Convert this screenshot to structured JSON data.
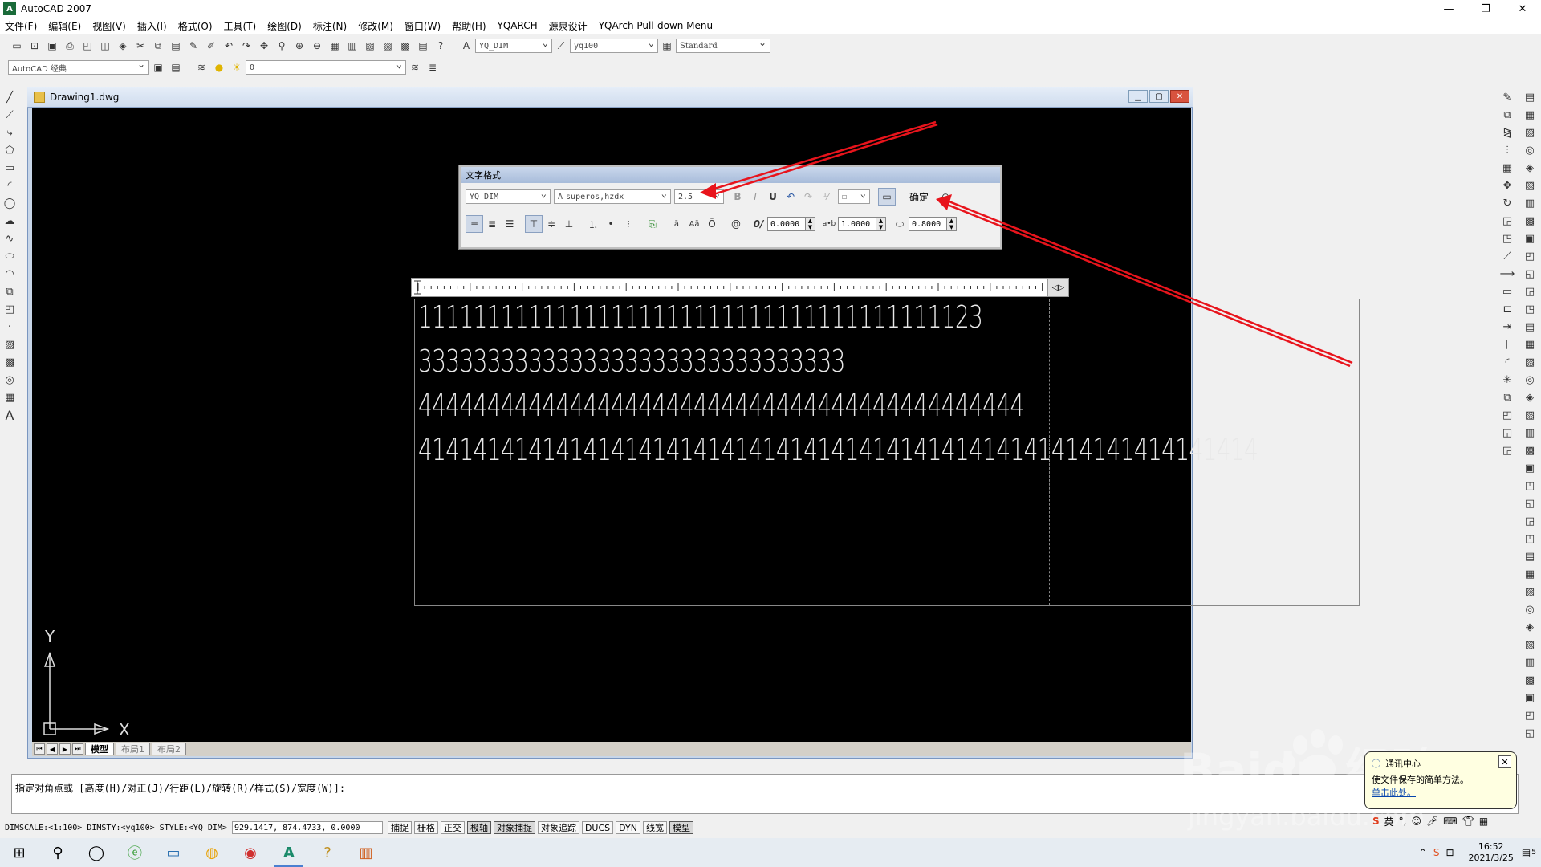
{
  "app": {
    "title": "AutoCAD 2007",
    "win_buttons": [
      "—",
      "❐",
      "✕"
    ]
  },
  "menu": [
    "文件(F)",
    "编辑(E)",
    "视图(V)",
    "插入(I)",
    "格式(O)",
    "工具(T)",
    "绘图(D)",
    "标注(N)",
    "修改(M)",
    "窗口(W)",
    "帮助(H)",
    "YQARCH",
    "源泉设计",
    "YQArch Pull-down Menu"
  ],
  "toolbar1": {
    "dimstyle": "YQ_DIM",
    "textstyle": "yq100",
    "tablestyle": "Standard"
  },
  "toolbar2": {
    "workspace": "AutoCAD 经典",
    "layer": "0"
  },
  "drawing": {
    "title": "Drawing1.dwg",
    "tabs": [
      "模型",
      "布局1",
      "布局2"
    ]
  },
  "text_format": {
    "title": "文字格式",
    "style": "YQ_DIM",
    "font": "superos,hzdx",
    "height": "2.5",
    "ok": "确定",
    "oblique": "0.0000",
    "tracking": "1.0000",
    "width": "0.8000"
  },
  "mtext_lines": [
    "11111111111111111111111111111111111111123",
    "3333333333333333333333333333333",
    "44444444444444444444444444444444444444444444",
    "4141414141414141414141414141414141414141414141414141414141414"
  ],
  "ucs": {
    "y": "Y",
    "x": "X"
  },
  "command": {
    "prompt": "指定对角点或 [高度(H)/对正(J)/行距(L)/旋转(R)/样式(S)/宽度(W)]:"
  },
  "status": {
    "dimscale": "DIMSCALE:<1:100> DIMSTY:<yq100> STYLE:<YQ_DIM>",
    "coords": "929.1417, 874.4733, 0.0000",
    "buttons": [
      "捕捉",
      "栅格",
      "正交",
      "极轴",
      "对象捕捉",
      "对象追踪",
      "DUCS",
      "DYN",
      "线宽",
      "模型"
    ]
  },
  "balloon": {
    "title": "通讯中心",
    "text": "使文件保存的简单方法。",
    "link": "单击此处。"
  },
  "taskbar": {
    "time": "16:52",
    "date": "2021/3/25",
    "lang": "英",
    "notif": "5"
  },
  "watermark": {
    "brand": "Baidu 经验",
    "url": "jingyan.baidu.com"
  },
  "colors": {
    "canvas": "#000000",
    "annotation_arrow": "#e8141c",
    "dwg_title": "#cfdcee"
  }
}
